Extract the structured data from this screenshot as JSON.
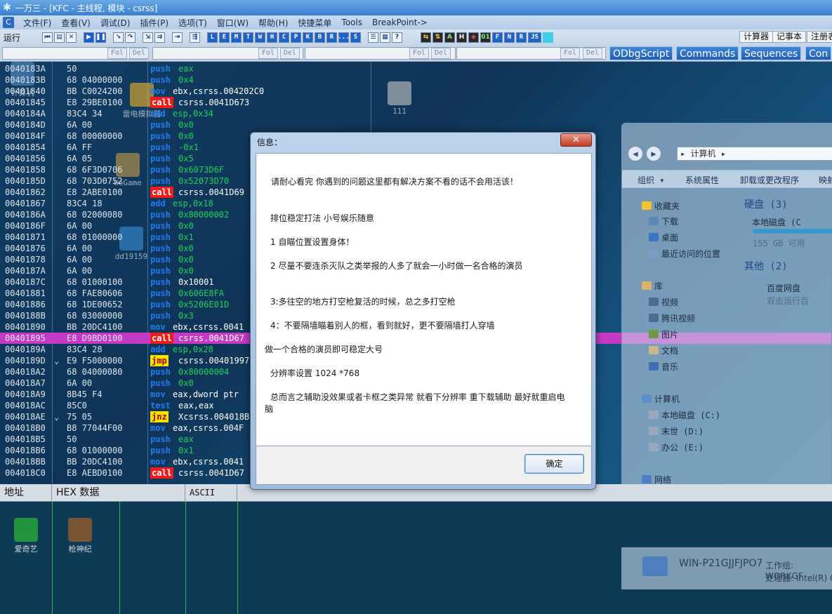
{
  "title": "一万三 - [KFC - 主线程, 模块 - csrss]",
  "menu": [
    "文件(F)",
    "查看(V)",
    "调试(D)",
    "插件(P)",
    "选项(T)",
    "窗口(W)",
    "帮助(H)",
    "快捷菜单",
    "Tools",
    "BreakPoint->"
  ],
  "toolbar": {
    "status": "运行",
    "letters": [
      "L",
      "E",
      "M",
      "T",
      "W",
      "H",
      "C",
      "P",
      "K",
      "B",
      "R",
      "...",
      "S"
    ],
    "fn_letters": [
      "F",
      "N",
      "R",
      "JS"
    ],
    "calc_label": "计算器",
    "notepad_label": "记事本",
    "register_label": "注册表"
  },
  "toolbar2": {
    "fol_label": "Fol",
    "del_label": "Del",
    "plugin_tabs": [
      "ODbgScript",
      "Commands",
      "Sequences",
      "Con"
    ]
  },
  "disasm": [
    {
      "addr": "0040183A",
      "hex": "50",
      "mnem": "push",
      "op": "eax",
      "type": "normal"
    },
    {
      "addr": "0040183B",
      "hex": "68 04000000",
      "mnem": "push",
      "op": "0x4",
      "type": "normal"
    },
    {
      "addr": "00401840",
      "hex": "BB C0024200",
      "mnem": "mov",
      "op": "ebx,csrss.004202C0",
      "type": "mov"
    },
    {
      "addr": "00401845",
      "hex": "E8 29BE0100",
      "mnem": "call",
      "op": "csrss.0041D673",
      "type": "call"
    },
    {
      "addr": "0040184A",
      "hex": "83C4 34",
      "mnem": "add",
      "op": "esp,0x34",
      "type": "normal"
    },
    {
      "addr": "0040184D",
      "hex": "6A 00",
      "mnem": "push",
      "op": "0x0",
      "type": "normal"
    },
    {
      "addr": "0040184F",
      "hex": "68 00000000",
      "mnem": "push",
      "op": "0x0",
      "type": "normal"
    },
    {
      "addr": "00401854",
      "hex": "6A FF",
      "mnem": "push",
      "op": "-0x1",
      "type": "normal"
    },
    {
      "addr": "00401856",
      "hex": "6A 05",
      "mnem": "push",
      "op": "0x5",
      "type": "normal"
    },
    {
      "addr": "00401858",
      "hex": "68 6F3D0706",
      "mnem": "push",
      "op": "0x6073D6F",
      "type": "normal"
    },
    {
      "addr": "0040185D",
      "hex": "68 703D0752",
      "mnem": "push",
      "op": "0x52073D70",
      "type": "normal"
    },
    {
      "addr": "00401862",
      "hex": "E8 2ABE0100",
      "mnem": "call",
      "op": "csrss.0041D69",
      "type": "call"
    },
    {
      "addr": "00401867",
      "hex": "83C4 18",
      "mnem": "add",
      "op": "esp,0x18",
      "type": "normal"
    },
    {
      "addr": "0040186A",
      "hex": "68 02000080",
      "mnem": "push",
      "op": "0x80000002",
      "type": "normal"
    },
    {
      "addr": "0040186F",
      "hex": "6A 00",
      "mnem": "push",
      "op": "0x0",
      "type": "normal"
    },
    {
      "addr": "00401871",
      "hex": "68 01000000",
      "mnem": "push",
      "op": "0x1",
      "type": "normal"
    },
    {
      "addr": "00401876",
      "hex": "6A 00",
      "mnem": "push",
      "op": "0x0",
      "type": "normal"
    },
    {
      "addr": "00401878",
      "hex": "6A 00",
      "mnem": "push",
      "op": "0x0",
      "type": "normal"
    },
    {
      "addr": "0040187A",
      "hex": "6A 00",
      "mnem": "push",
      "op": "0x0",
      "type": "normal"
    },
    {
      "addr": "0040187C",
      "hex": "68 01000100",
      "mnem": "push",
      "op": "0x10001",
      "type": "mov"
    },
    {
      "addr": "00401881",
      "hex": "68 FAE80606",
      "mnem": "push",
      "op": "0x606E8FA",
      "type": "normal"
    },
    {
      "addr": "00401886",
      "hex": "68 1DE00652",
      "mnem": "push",
      "op": "0x5206E01D",
      "type": "normal"
    },
    {
      "addr": "0040188B",
      "hex": "68 03000000",
      "mnem": "push",
      "op": "0x3",
      "type": "normal"
    },
    {
      "addr": "00401890",
      "hex": "BB 20DC4100",
      "mnem": "mov",
      "op": "ebx,csrss.0041",
      "type": "mov"
    },
    {
      "addr": "00401895",
      "hex": "E8 D9BD0100",
      "mnem": "call",
      "op": "csrss.0041D67",
      "type": "call",
      "selected": true
    },
    {
      "addr": "0040189A",
      "hex": "83C4 28",
      "mnem": "add",
      "op": "esp,0x28",
      "type": "normal"
    },
    {
      "addr": "0040189D",
      "hex": "E9 F5000000",
      "mnem": "jmp",
      "op": "csrss.00401997",
      "type": "jmp",
      "jmark": "⌄"
    },
    {
      "addr": "004018A2",
      "hex": "68 04000080",
      "mnem": "push",
      "op": "0x80000004",
      "type": "normal"
    },
    {
      "addr": "004018A7",
      "hex": "6A 00",
      "mnem": "push",
      "op": "0x0",
      "type": "normal"
    },
    {
      "addr": "004018A9",
      "hex": "8B45 F4",
      "mnem": "mov",
      "op": "eax,dword ptr",
      "type": "mov"
    },
    {
      "addr": "004018AC",
      "hex": "85C0",
      "mnem": "test",
      "op": "eax,eax",
      "type": "mov"
    },
    {
      "addr": "004018AE",
      "hex": "75 05",
      "mnem": "jnz",
      "op": "Xcsrss.004018B",
      "type": "jmp",
      "jmark": "⌄"
    },
    {
      "addr": "004018B0",
      "hex": "B8 77044F00",
      "mnem": "mov",
      "op": "eax,csrss.004F",
      "type": "mov"
    },
    {
      "addr": "004018B5",
      "hex": "50",
      "mnem": "push",
      "op": "eax",
      "type": "normal"
    },
    {
      "addr": "004018B6",
      "hex": "68 01000000",
      "mnem": "push",
      "op": "0x1",
      "type": "normal"
    },
    {
      "addr": "004018BB",
      "hex": "BB 20DC4100",
      "mnem": "mov",
      "op": "ebx,csrss.0041",
      "type": "mov"
    },
    {
      "addr": "004018C0",
      "hex": "E8 AEBD0100",
      "mnem": "call",
      "op": "csrss.0041D67",
      "type": "call"
    }
  ],
  "desktop_icons": [
    {
      "label": "计算机",
      "color": "#5b8fc9"
    },
    {
      "label": "雷电模拟器",
      "color": "#f0b82a"
    },
    {
      "label": "111",
      "color": "#c9c9c9"
    },
    {
      "label": "WeGame",
      "color": "#c8a046"
    },
    {
      "label": "dd19159",
      "color": "#3a8fd6"
    },
    {
      "label": "爱奇艺",
      "color": "#27a33a"
    },
    {
      "label": "枪神纪",
      "color": "#8d5a2e"
    }
  ],
  "explorer": {
    "address": "计算机",
    "commands": [
      "组织 ▾",
      "系统属性",
      "卸载或更改程序",
      "映射"
    ],
    "favorites_label": "收藏夹",
    "favorites": [
      "下载",
      "桌面",
      "最近访问的位置"
    ],
    "library_label": "库",
    "libraries": [
      "视频",
      "腾讯视频",
      "图片",
      "文档",
      "音乐"
    ],
    "computer_label": "计算机",
    "drives": [
      "本地磁盘 (C:)",
      "末世 (D:)",
      "办公 (E:)"
    ],
    "network_label": "网络",
    "hard_disk_group": "硬盘 (3)",
    "local_disk_label": "本地磁盘 (C",
    "free_space": "155 GB 可用",
    "other_group": "其他 (2)",
    "netdisk_label": "百度网盘",
    "netdisk_sub": "双击运行百",
    "pc_name": "WIN-P21GJJFJPO7",
    "workgroup": "工作组: WORKGF",
    "processor": "处理器: Intel(R) C"
  },
  "dump": {
    "col_address": "地址",
    "col_hex": "HEX 数据",
    "col_ascii": "ASCII"
  },
  "dialog": {
    "title": "信息：",
    "close": "✕",
    "lines": [
      "请耐心看完 你遇到的问题这里都有解决方案不看的话不会用活该！",
      "排位稳定打法 小号娱乐随意",
      "1 自瞄位置设置身体！",
      "2 尽量不要连杀灭队之类举报的人多了就会一小时做一名合格的演员",
      "3:多往空的地方打空枪复活的时候，总之多打空枪",
      "4：不要隔墙瞄着别人的框，看到就好，更不要隔墙打人穿墙",
      "做一个合格的演员即可稳定大号",
      "分辨率设置 1024 *768",
      "总而言之辅助没效果或者卡框之类异常 就看下分辨率 重下载辅助 最好就重启电",
      "脑"
    ],
    "ok": "确定"
  }
}
